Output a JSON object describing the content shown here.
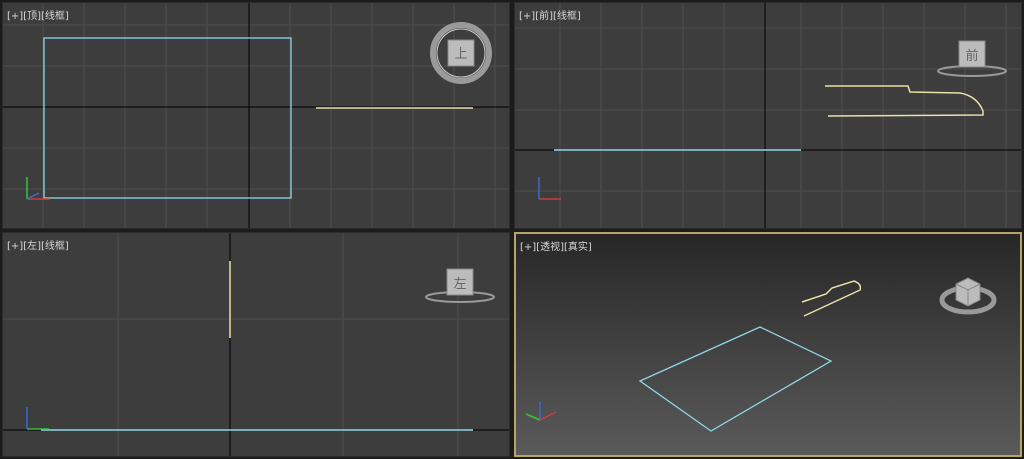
{
  "viewports": {
    "top": {
      "menu": "[+]",
      "view": "[顶]",
      "shading": "[线框]",
      "viewcube_label": "上"
    },
    "front": {
      "menu": "[+]",
      "view": "[前]",
      "shading": "[线框]",
      "viewcube_label": "前"
    },
    "left": {
      "menu": "[+]",
      "view": "[左]",
      "shading": "[线框]",
      "viewcube_label": "左"
    },
    "perspective": {
      "menu": "[+]",
      "view": "[透视]",
      "shading": "[真实]",
      "active": true
    }
  },
  "colors": {
    "viewport_bg": "#3d3d3d",
    "grid": "#4e4e4e",
    "axis_line": "#000000",
    "shape_cyan": "#8fd6e6",
    "shape_yellow": "#e8e0a6",
    "active_border": "#b9a36b",
    "axis_x": "#d03a3a",
    "axis_y": "#3ac23a",
    "axis_z": "#3a6ad0"
  }
}
